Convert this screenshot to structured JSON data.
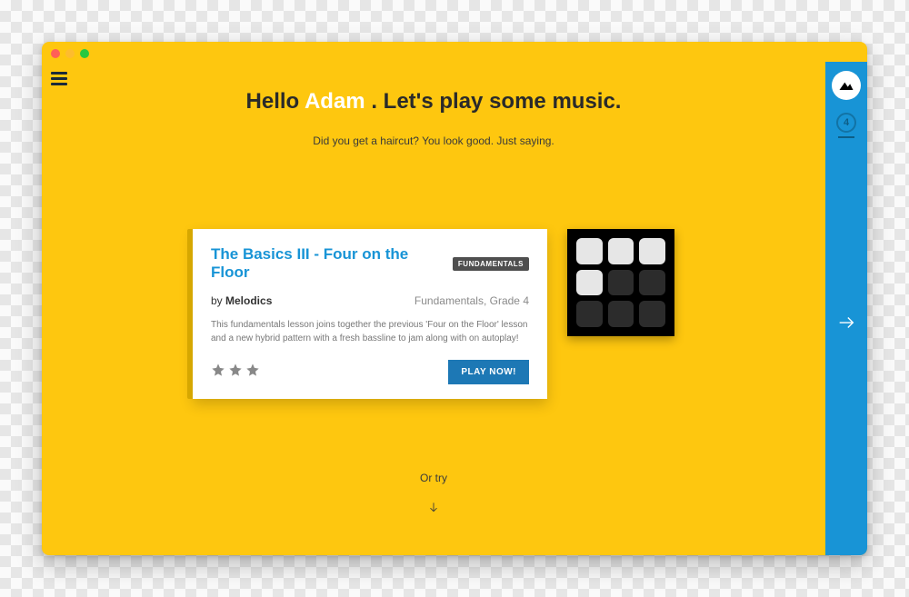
{
  "greeting": {
    "prefix": "Hello ",
    "name": "Adam",
    "suffix": " . Let's play some music."
  },
  "subtitle": "Did you get a haircut? You look good. Just saying.",
  "lesson": {
    "title": "The Basics III - Four on the Floor",
    "badge": "FUNDAMENTALS",
    "by_prefix": "by ",
    "author": "Melodics",
    "grade": "Fundamentals, Grade 4",
    "description": "This fundamentals lesson joins together the previous 'Four on the Floor' lesson and a new hybrid pattern with a fresh bassline to jam along with on autoplay!",
    "stars": 3,
    "play_label": "PLAY NOW!"
  },
  "or_try": "Or try",
  "sidebar": {
    "level": "4"
  }
}
